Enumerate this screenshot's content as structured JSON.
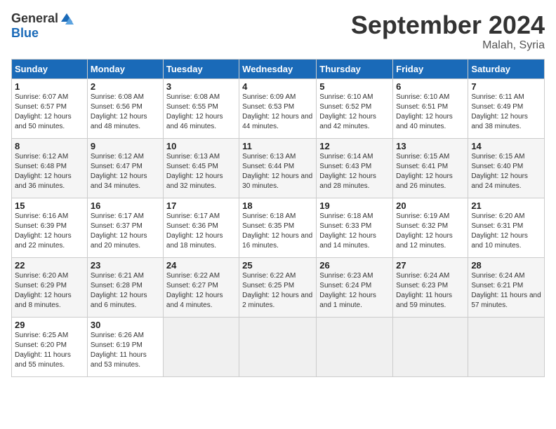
{
  "header": {
    "logo_general": "General",
    "logo_blue": "Blue",
    "month_title": "September 2024",
    "location": "Malah, Syria"
  },
  "days_of_week": [
    "Sunday",
    "Monday",
    "Tuesday",
    "Wednesday",
    "Thursday",
    "Friday",
    "Saturday"
  ],
  "weeks": [
    [
      {
        "day": "1",
        "sunrise": "6:07 AM",
        "sunset": "6:57 PM",
        "daylight": "12 hours and 50 minutes."
      },
      {
        "day": "2",
        "sunrise": "6:08 AM",
        "sunset": "6:56 PM",
        "daylight": "12 hours and 48 minutes."
      },
      {
        "day": "3",
        "sunrise": "6:08 AM",
        "sunset": "6:55 PM",
        "daylight": "12 hours and 46 minutes."
      },
      {
        "day": "4",
        "sunrise": "6:09 AM",
        "sunset": "6:53 PM",
        "daylight": "12 hours and 44 minutes."
      },
      {
        "day": "5",
        "sunrise": "6:10 AM",
        "sunset": "6:52 PM",
        "daylight": "12 hours and 42 minutes."
      },
      {
        "day": "6",
        "sunrise": "6:10 AM",
        "sunset": "6:51 PM",
        "daylight": "12 hours and 40 minutes."
      },
      {
        "day": "7",
        "sunrise": "6:11 AM",
        "sunset": "6:49 PM",
        "daylight": "12 hours and 38 minutes."
      }
    ],
    [
      {
        "day": "8",
        "sunrise": "6:12 AM",
        "sunset": "6:48 PM",
        "daylight": "12 hours and 36 minutes."
      },
      {
        "day": "9",
        "sunrise": "6:12 AM",
        "sunset": "6:47 PM",
        "daylight": "12 hours and 34 minutes."
      },
      {
        "day": "10",
        "sunrise": "6:13 AM",
        "sunset": "6:45 PM",
        "daylight": "12 hours and 32 minutes."
      },
      {
        "day": "11",
        "sunrise": "6:13 AM",
        "sunset": "6:44 PM",
        "daylight": "12 hours and 30 minutes."
      },
      {
        "day": "12",
        "sunrise": "6:14 AM",
        "sunset": "6:43 PM",
        "daylight": "12 hours and 28 minutes."
      },
      {
        "day": "13",
        "sunrise": "6:15 AM",
        "sunset": "6:41 PM",
        "daylight": "12 hours and 26 minutes."
      },
      {
        "day": "14",
        "sunrise": "6:15 AM",
        "sunset": "6:40 PM",
        "daylight": "12 hours and 24 minutes."
      }
    ],
    [
      {
        "day": "15",
        "sunrise": "6:16 AM",
        "sunset": "6:39 PM",
        "daylight": "12 hours and 22 minutes."
      },
      {
        "day": "16",
        "sunrise": "6:17 AM",
        "sunset": "6:37 PM",
        "daylight": "12 hours and 20 minutes."
      },
      {
        "day": "17",
        "sunrise": "6:17 AM",
        "sunset": "6:36 PM",
        "daylight": "12 hours and 18 minutes."
      },
      {
        "day": "18",
        "sunrise": "6:18 AM",
        "sunset": "6:35 PM",
        "daylight": "12 hours and 16 minutes."
      },
      {
        "day": "19",
        "sunrise": "6:18 AM",
        "sunset": "6:33 PM",
        "daylight": "12 hours and 14 minutes."
      },
      {
        "day": "20",
        "sunrise": "6:19 AM",
        "sunset": "6:32 PM",
        "daylight": "12 hours and 12 minutes."
      },
      {
        "day": "21",
        "sunrise": "6:20 AM",
        "sunset": "6:31 PM",
        "daylight": "12 hours and 10 minutes."
      }
    ],
    [
      {
        "day": "22",
        "sunrise": "6:20 AM",
        "sunset": "6:29 PM",
        "daylight": "12 hours and 8 minutes."
      },
      {
        "day": "23",
        "sunrise": "6:21 AM",
        "sunset": "6:28 PM",
        "daylight": "12 hours and 6 minutes."
      },
      {
        "day": "24",
        "sunrise": "6:22 AM",
        "sunset": "6:27 PM",
        "daylight": "12 hours and 4 minutes."
      },
      {
        "day": "25",
        "sunrise": "6:22 AM",
        "sunset": "6:25 PM",
        "daylight": "12 hours and 2 minutes."
      },
      {
        "day": "26",
        "sunrise": "6:23 AM",
        "sunset": "6:24 PM",
        "daylight": "12 hours and 1 minute."
      },
      {
        "day": "27",
        "sunrise": "6:24 AM",
        "sunset": "6:23 PM",
        "daylight": "11 hours and 59 minutes."
      },
      {
        "day": "28",
        "sunrise": "6:24 AM",
        "sunset": "6:21 PM",
        "daylight": "11 hours and 57 minutes."
      }
    ],
    [
      {
        "day": "29",
        "sunrise": "6:25 AM",
        "sunset": "6:20 PM",
        "daylight": "11 hours and 55 minutes."
      },
      {
        "day": "30",
        "sunrise": "6:26 AM",
        "sunset": "6:19 PM",
        "daylight": "11 hours and 53 minutes."
      },
      null,
      null,
      null,
      null,
      null
    ]
  ]
}
